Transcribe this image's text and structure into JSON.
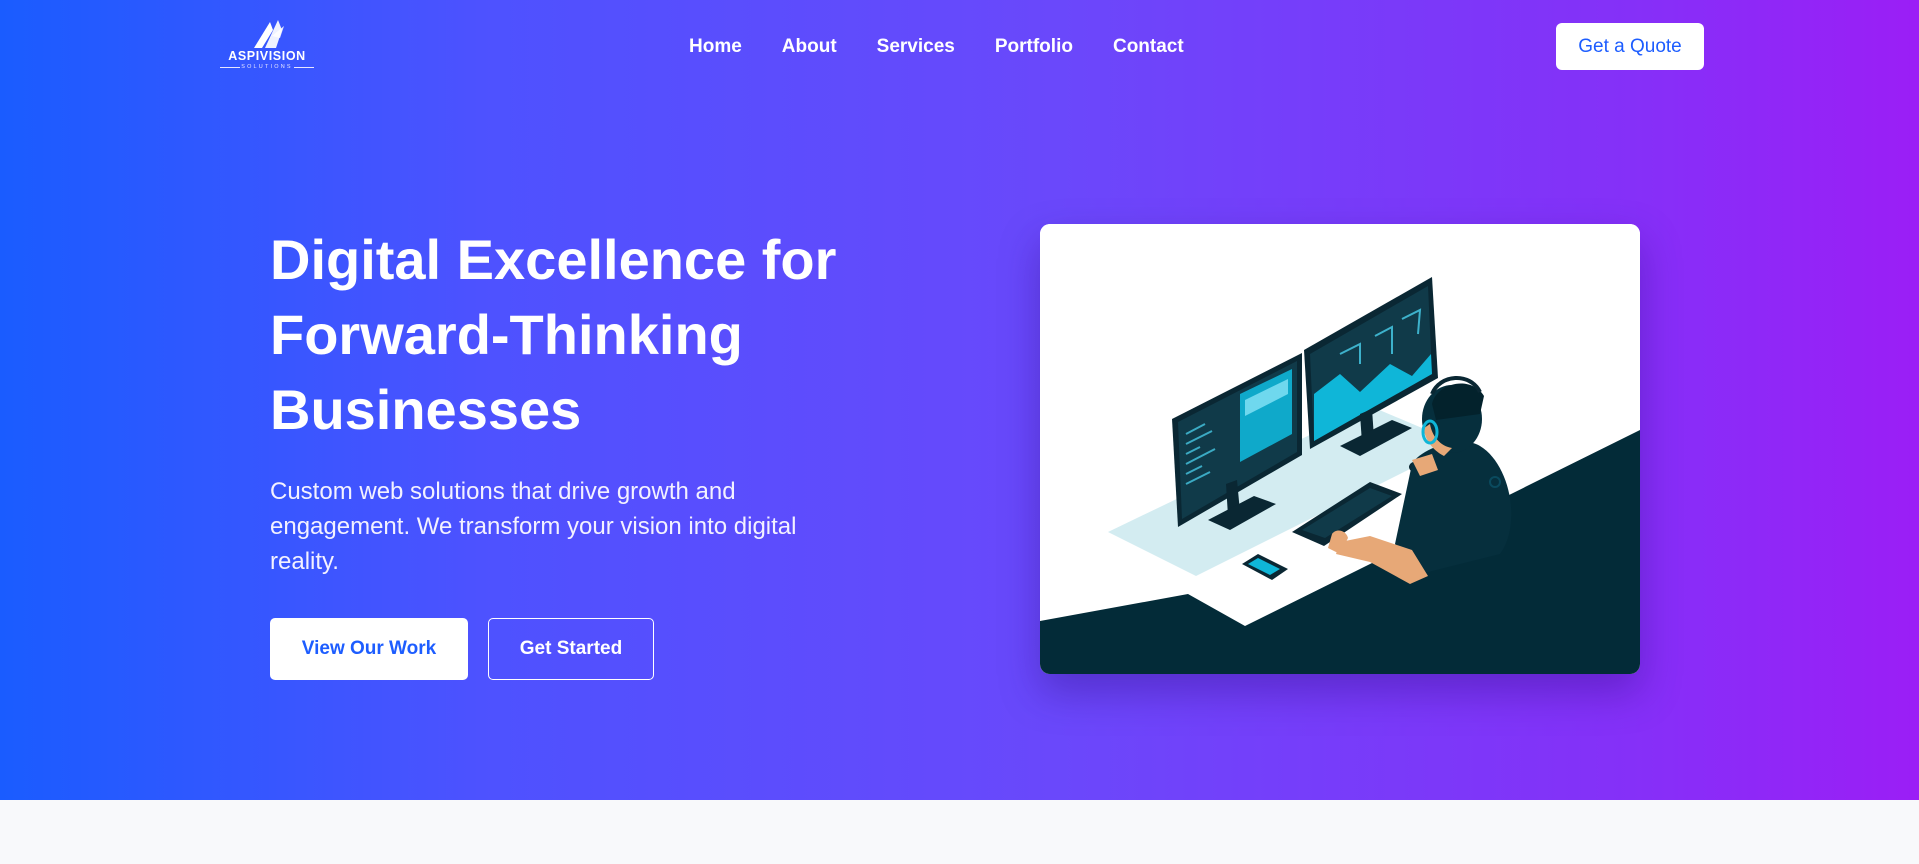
{
  "brand": {
    "name": "ASPIVISION",
    "tagline": "SOLUTIONS"
  },
  "nav": {
    "items": [
      "Home",
      "About",
      "Services",
      "Portfolio",
      "Contact"
    ],
    "cta": "Get a Quote"
  },
  "hero": {
    "headline_lines": [
      "Digital Excellence for",
      "Forward-Thinking",
      "Businesses"
    ],
    "subtext_lines": [
      "Custom web solutions that drive growth and",
      "engagement. We transform your vision into digital",
      "reality."
    ],
    "primary_button": "View Our Work",
    "secondary_button": "Get Started",
    "illustration": "developer-at-dual-monitors-illustration"
  },
  "colors": {
    "gradient_start": "#1a5cff",
    "gradient_end": "#9b1ef6",
    "accent_text": "#1d5dff",
    "illustration_dark": "#032b38",
    "illustration_cyan": "#0fb6d8"
  }
}
